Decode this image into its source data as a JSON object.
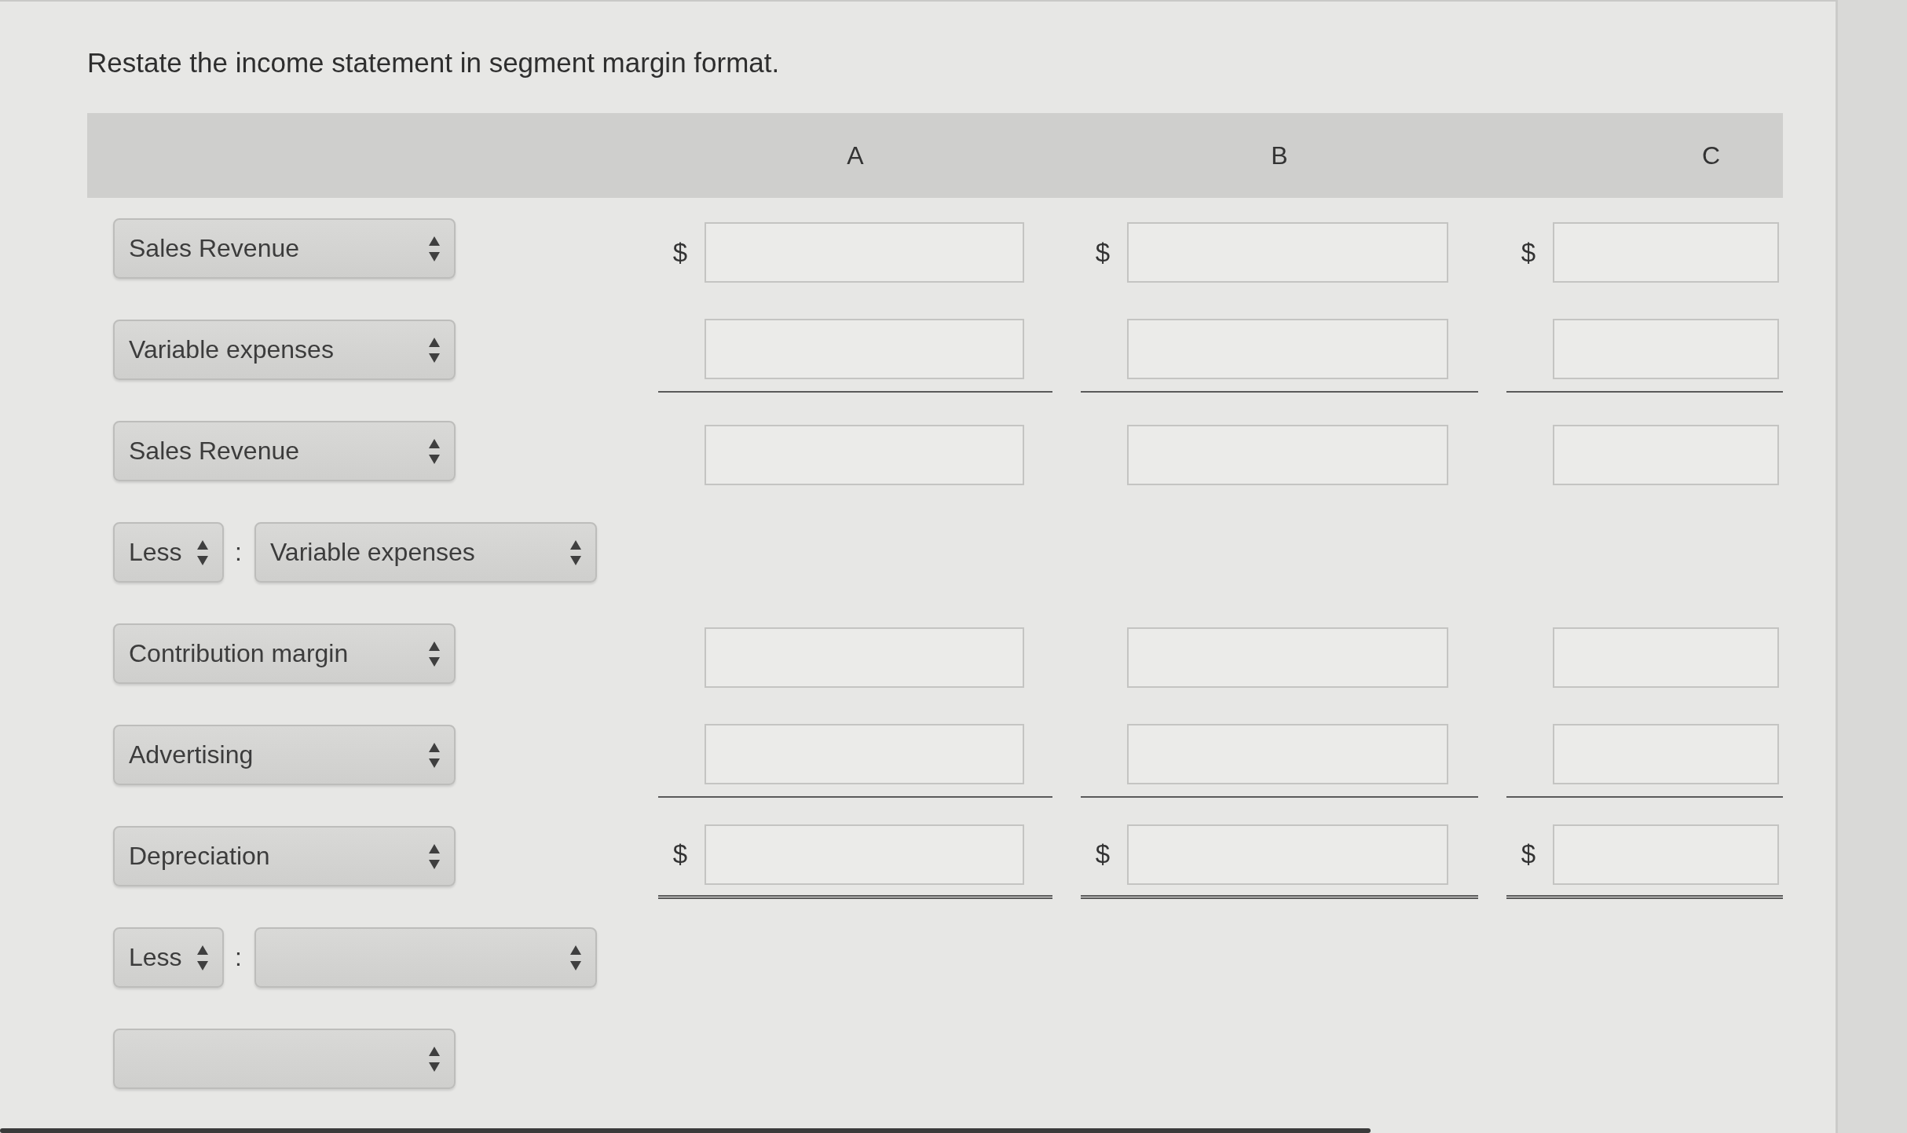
{
  "instruction": "Restate the income statement in segment margin format.",
  "table": {
    "columns": [
      "A",
      "B",
      "C"
    ],
    "rows": [
      {
        "kind": "select",
        "selection": "Sales Revenue",
        "amount_fields": true,
        "currency": [
          "$",
          "$",
          "$"
        ]
      },
      {
        "kind": "select",
        "selection": "Variable expenses",
        "amount_fields": true,
        "underline": true,
        "double": false
      },
      {
        "kind": "select",
        "selection": "Sales Revenue",
        "amount_fields": true
      },
      {
        "kind": "less",
        "operator": "Less",
        "separator": ":",
        "selection": "Variable expenses",
        "amount_fields": false
      },
      {
        "kind": "select",
        "selection": "Contribution margin",
        "amount_fields": true
      },
      {
        "kind": "select",
        "selection": "Advertising",
        "amount_fields": true,
        "underline": true,
        "double": false
      },
      {
        "kind": "select",
        "selection": "Depreciation",
        "amount_fields": true,
        "currency": [
          "$",
          "$",
          "$"
        ],
        "underline": true,
        "double": true
      },
      {
        "kind": "less",
        "operator": "Less",
        "separator": ":",
        "amount_fields": false
      },
      {
        "kind": "select",
        "amount_fields": false
      }
    ]
  }
}
